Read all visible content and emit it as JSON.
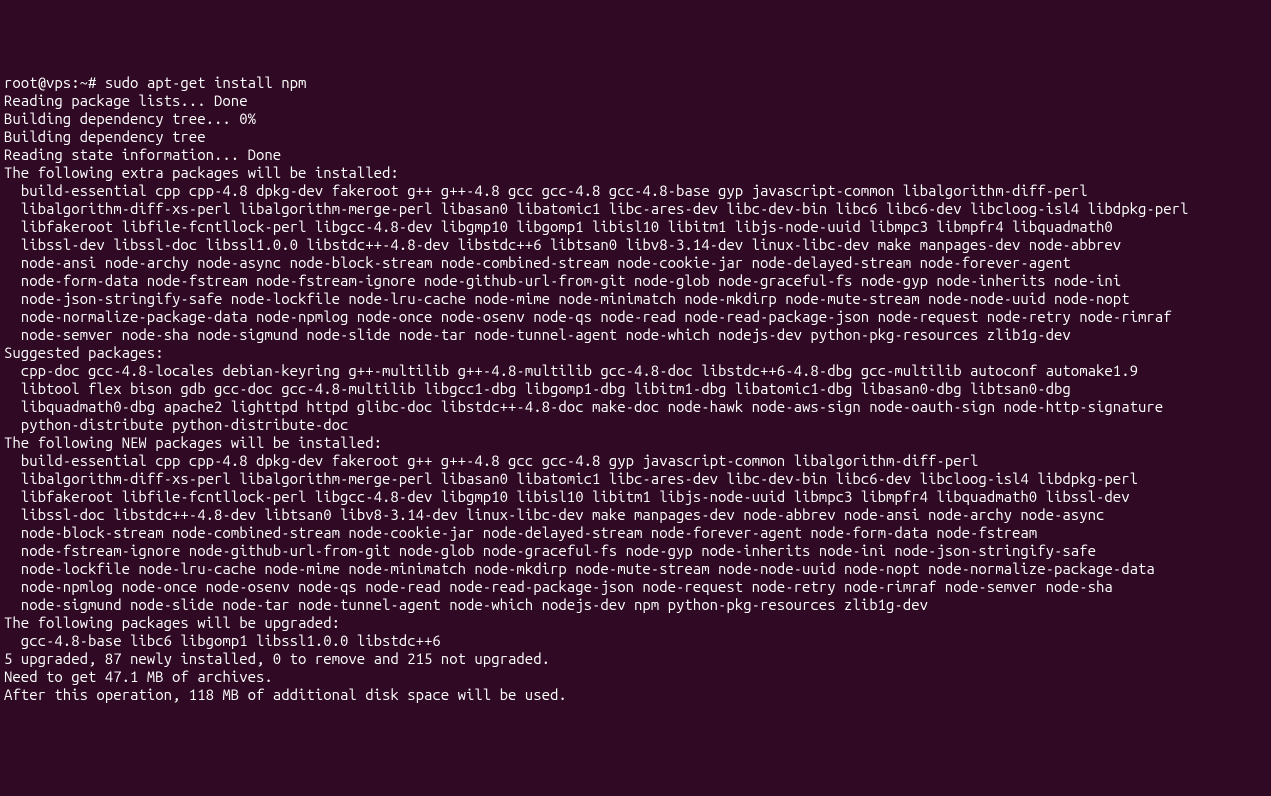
{
  "terminal": {
    "prompt": "root@vps:~# ",
    "command": "sudo apt-get install npm",
    "lines": [
      "Reading package lists... Done",
      "Building dependency tree... 0%",
      "Building dependency tree",
      "Reading state information... Done",
      "The following extra packages will be installed:"
    ],
    "extra_packages": [
      "build-essential cpp cpp-4.8 dpkg-dev fakeroot g++ g++-4.8 gcc gcc-4.8 gcc-4.8-base gyp javascript-common libalgorithm-diff-perl",
      "libalgorithm-diff-xs-perl libalgorithm-merge-perl libasan0 libatomic1 libc-ares-dev libc-dev-bin libc6 libc6-dev libcloog-isl4 libdpkg-perl",
      "libfakeroot libfile-fcntllock-perl libgcc-4.8-dev libgmp10 libgomp1 libisl10 libitm1 libjs-node-uuid libmpc3 libmpfr4 libquadmath0",
      "libssl-dev libssl-doc libssl1.0.0 libstdc++-4.8-dev libstdc++6 libtsan0 libv8-3.14-dev linux-libc-dev make manpages-dev node-abbrev",
      "node-ansi node-archy node-async node-block-stream node-combined-stream node-cookie-jar node-delayed-stream node-forever-agent",
      "node-form-data node-fstream node-fstream-ignore node-github-url-from-git node-glob node-graceful-fs node-gyp node-inherits node-ini",
      "node-json-stringify-safe node-lockfile node-lru-cache node-mime node-minimatch node-mkdirp node-mute-stream node-node-uuid node-nopt",
      "node-normalize-package-data node-npmlog node-once node-osenv node-qs node-read node-read-package-json node-request node-retry node-rimraf",
      "node-semver node-sha node-sigmund node-slide node-tar node-tunnel-agent node-which nodejs-dev python-pkg-resources zlib1g-dev"
    ],
    "suggested_header": "Suggested packages:",
    "suggested_packages": [
      "cpp-doc gcc-4.8-locales debian-keyring g++-multilib g++-4.8-multilib gcc-4.8-doc libstdc++6-4.8-dbg gcc-multilib autoconf automake1.9",
      "libtool flex bison gdb gcc-doc gcc-4.8-multilib libgcc1-dbg libgomp1-dbg libitm1-dbg libatomic1-dbg libasan0-dbg libtsan0-dbg",
      "libquadmath0-dbg apache2 lighttpd httpd glibc-doc libstdc++-4.8-doc make-doc node-hawk node-aws-sign node-oauth-sign node-http-signature",
      "python-distribute python-distribute-doc"
    ],
    "new_header": "The following NEW packages will be installed:",
    "new_packages": [
      "build-essential cpp cpp-4.8 dpkg-dev fakeroot g++ g++-4.8 gcc gcc-4.8 gyp javascript-common libalgorithm-diff-perl",
      "libalgorithm-diff-xs-perl libalgorithm-merge-perl libasan0 libatomic1 libc-ares-dev libc-dev-bin libc6-dev libcloog-isl4 libdpkg-perl",
      "libfakeroot libfile-fcntllock-perl libgcc-4.8-dev libgmp10 libisl10 libitm1 libjs-node-uuid libmpc3 libmpfr4 libquadmath0 libssl-dev",
      "libssl-doc libstdc++-4.8-dev libtsan0 libv8-3.14-dev linux-libc-dev make manpages-dev node-abbrev node-ansi node-archy node-async",
      "node-block-stream node-combined-stream node-cookie-jar node-delayed-stream node-forever-agent node-form-data node-fstream",
      "node-fstream-ignore node-github-url-from-git node-glob node-graceful-fs node-gyp node-inherits node-ini node-json-stringify-safe",
      "node-lockfile node-lru-cache node-mime node-minimatch node-mkdirp node-mute-stream node-node-uuid node-nopt node-normalize-package-data",
      "node-npmlog node-once node-osenv node-qs node-read node-read-package-json node-request node-retry node-rimraf node-semver node-sha",
      "node-sigmund node-slide node-tar node-tunnel-agent node-which nodejs-dev npm python-pkg-resources zlib1g-dev"
    ],
    "upgraded_header": "The following packages will be upgraded:",
    "upgraded_packages": [
      "gcc-4.8-base libc6 libgomp1 libssl1.0.0 libstdc++6"
    ],
    "summary_lines": [
      "5 upgraded, 87 newly installed, 0 to remove and 215 not upgraded.",
      "Need to get 47.1 MB of archives.",
      "After this operation, 118 MB of additional disk space will be used."
    ]
  }
}
